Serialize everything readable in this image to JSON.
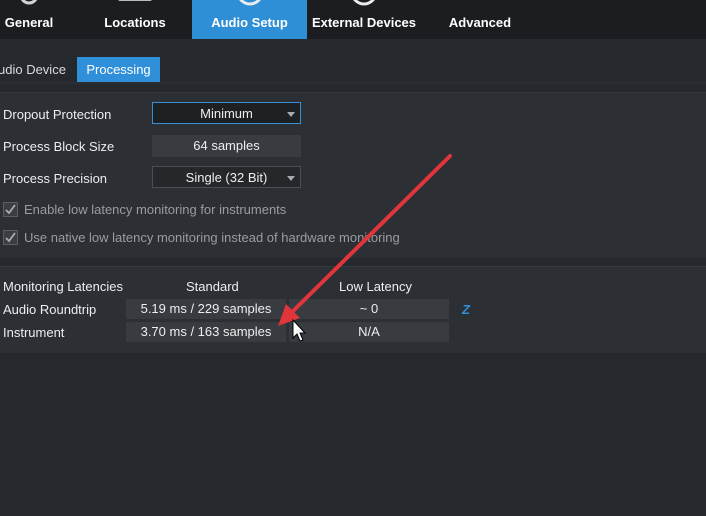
{
  "top_tabs": [
    {
      "label": "General",
      "icon": "gear-icon",
      "active": false
    },
    {
      "label": "Locations",
      "icon": "folder-icon",
      "active": false
    },
    {
      "label": "Audio Setup",
      "icon": "speaker-icon",
      "active": true
    },
    {
      "label": "External Devices",
      "icon": "device-icon",
      "active": false
    },
    {
      "label": "Advanced",
      "icon": "gear-icon",
      "active": false
    }
  ],
  "sub_tabs": [
    {
      "label": "udio Device",
      "active": false
    },
    {
      "label": "Processing",
      "active": true
    }
  ],
  "settings": {
    "dropout_protection": {
      "label": "Dropout Protection",
      "value": "Minimum"
    },
    "process_block_size": {
      "label": "Process Block Size",
      "value": "64 samples"
    },
    "process_precision": {
      "label": "Process Precision",
      "value": "Single (32 Bit)"
    },
    "low_latency_instruments": {
      "label": "Enable low latency monitoring for instruments",
      "checked": true
    },
    "native_low_latency": {
      "label": "Use native low latency monitoring instead of hardware monitoring",
      "checked": true
    }
  },
  "latencies": {
    "header": "Monitoring Latencies",
    "col_standard": "Standard",
    "col_low": "Low Latency",
    "rows": [
      {
        "label": "Audio Roundtrip",
        "standard": "5.19 ms / 229 samples",
        "low": "~ 0"
      },
      {
        "label": "Instrument",
        "standard": "3.70 ms / 163 samples",
        "low": "N/A"
      }
    ],
    "z_link": "Z"
  },
  "colors": {
    "accent": "#2e8fd6",
    "annotation_arrow": "#e0353a",
    "background": "#25282c"
  }
}
